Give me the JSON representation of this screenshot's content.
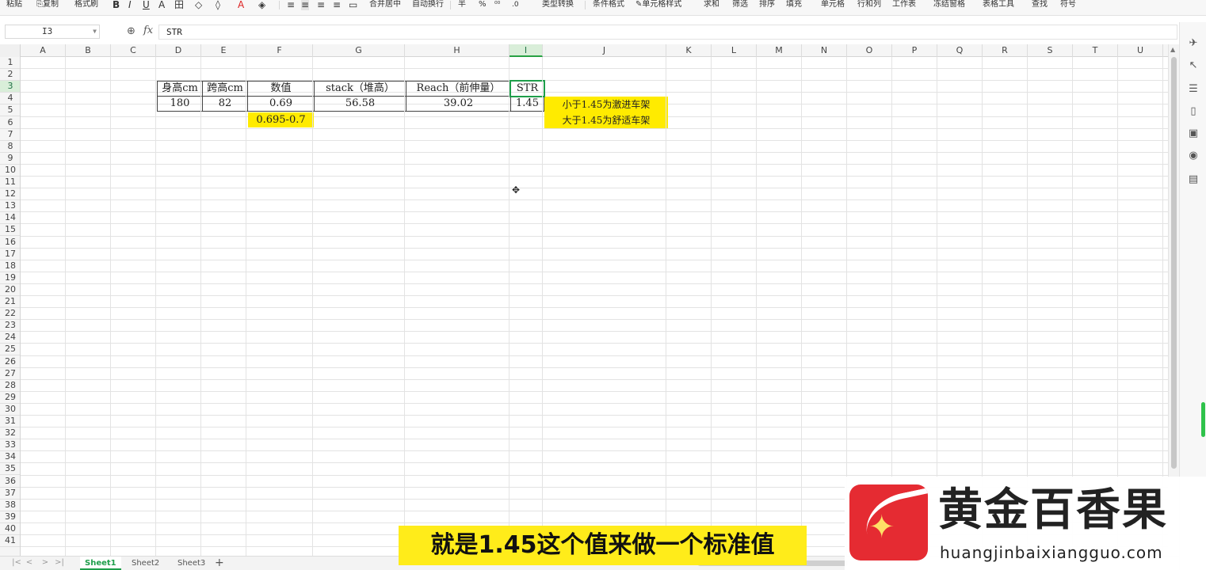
{
  "toolbar": {
    "items": [
      "粘贴",
      "复制",
      "格式刷",
      "B",
      "I",
      "U",
      "A",
      "田",
      "合并居中",
      "自动换行",
      "半",
      "%",
      "类型转换",
      "条件格式",
      "单元格样式",
      "求和",
      "筛选",
      "排序",
      "填充",
      "单元格",
      "行和列",
      "工作表",
      "冻结窗格",
      "表格工具",
      "查找",
      "符号"
    ]
  },
  "formula_bar": {
    "name_box": "I3",
    "fx_label": "fx",
    "formula": "STR"
  },
  "columns": [
    "A",
    "B",
    "C",
    "D",
    "E",
    "F",
    "G",
    "H",
    "I",
    "J",
    "K",
    "L",
    "M",
    "N",
    "O",
    "P",
    "Q",
    "R",
    "S",
    "T",
    "U"
  ],
  "rows": [
    "1",
    "2",
    "3",
    "4",
    "5",
    "6",
    "7",
    "8",
    "9",
    "10",
    "11",
    "12",
    "13",
    "14",
    "15",
    "16",
    "17",
    "18",
    "19",
    "20",
    "21",
    "22",
    "23",
    "24",
    "25",
    "26",
    "27",
    "28",
    "29",
    "30",
    "31",
    "32",
    "33",
    "34",
    "35",
    "36",
    "37",
    "38",
    "39",
    "40",
    "41"
  ],
  "active_cell": "I3",
  "table": {
    "headers": [
      "身高cm",
      "跨高cm",
      "数值",
      "stack（堆高）",
      "Reach（前伸量）",
      "STR"
    ],
    "values": [
      "180",
      "82",
      "0.69",
      "56.58",
      "39.02",
      "1.45"
    ],
    "range_note": "0.695-0.7",
    "notes": [
      "小于1.45为激进车架",
      "大于1.45为舒适车架"
    ]
  },
  "sheets": {
    "tabs": [
      "Sheet1",
      "Sheet2",
      "Sheet3"
    ],
    "active": "Sheet1",
    "add": "+"
  },
  "subtitle": "就是1.45这个值来做一个标准值",
  "watermark": {
    "title": "黄金百香果",
    "url": "huangjinbaixiangguo.com"
  },
  "colors": {
    "highlight": "#ffeb00",
    "selection": "#1e9e4a",
    "logo": "#e52b32"
  }
}
